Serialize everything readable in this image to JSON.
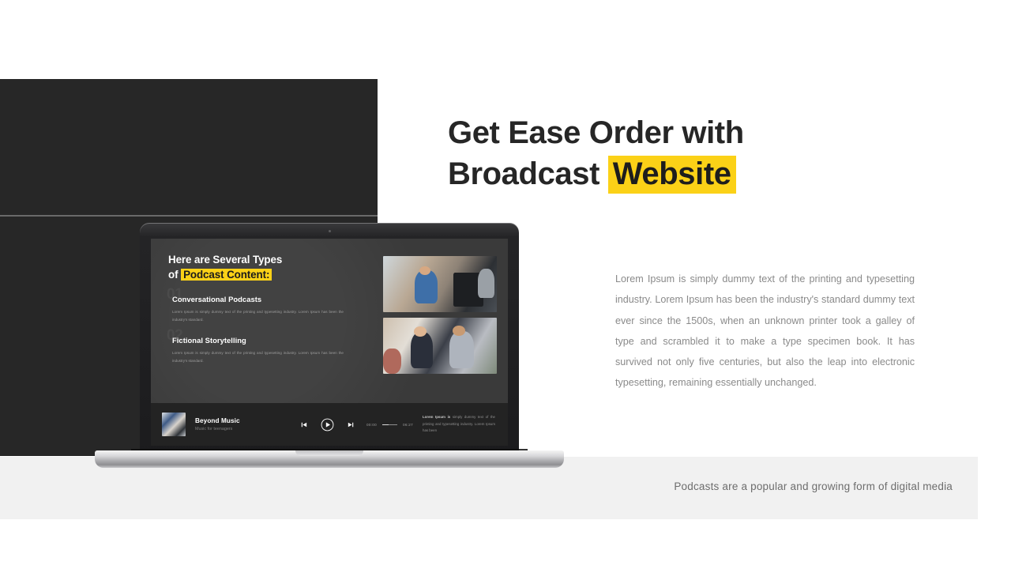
{
  "slide": {
    "headline": {
      "line1": "Get Ease Order with",
      "line2_prefix": "Broadcast ",
      "line2_highlight": "Website"
    },
    "body_copy": "Lorem Ipsum is simply dummy text of the printing and typesetting industry.  Lorem Ipsum has been the industry's standard dummy text ever since the 1500s,   when an unknown printer took a galley of type and scrambled it to make a type specimen book.  It has survived not only five centuries, but also the leap into electronic typesetting, remaining essentially unchanged.",
    "footer_caption": "Podcasts are a popular and growing form of digital media",
    "colors": {
      "highlight_yellow": "#fbd117",
      "dark_panel": "#272727",
      "heading": "#262626",
      "body_text": "#8a8a8a",
      "gray_bar": "#f1f1f1"
    }
  },
  "laptop_screen": {
    "title_line1": "Here are Several Types",
    "title_line2_prefix": "of ",
    "title_line2_highlight": "Podcast Content:",
    "topics": [
      {
        "number": "01",
        "name": "Conversational Podcasts",
        "description": "Lorem Ipsum is simply dummy text of the printing and typesetting industry.  Lorem Ipsum has been the industry's standard."
      },
      {
        "number": "02",
        "name": "Fictional Storytelling",
        "description": "Lorem Ipsum is simply dummy text of the printing and typesetting industry.  Lorem Ipsum has been the industry's standard."
      }
    ],
    "photos": [
      {
        "alt": "podcast-host-with-camera-photo"
      },
      {
        "alt": "two-women-recording-podcast-photo"
      }
    ],
    "player": {
      "thumbnail_alt": "album-art-thumbnail",
      "track_title": "Beyond Music",
      "track_subtitle": "Music for teenagers",
      "current_time": "00:00",
      "total_time": "06:27",
      "controls": [
        "previous-track-icon",
        "play-icon",
        "next-track-icon"
      ],
      "note_lead": "Lorem Ipsum is",
      "note_rest": " simply dummy text of the printing and typesetting industry.  Lorem Ipsum has been"
    }
  }
}
